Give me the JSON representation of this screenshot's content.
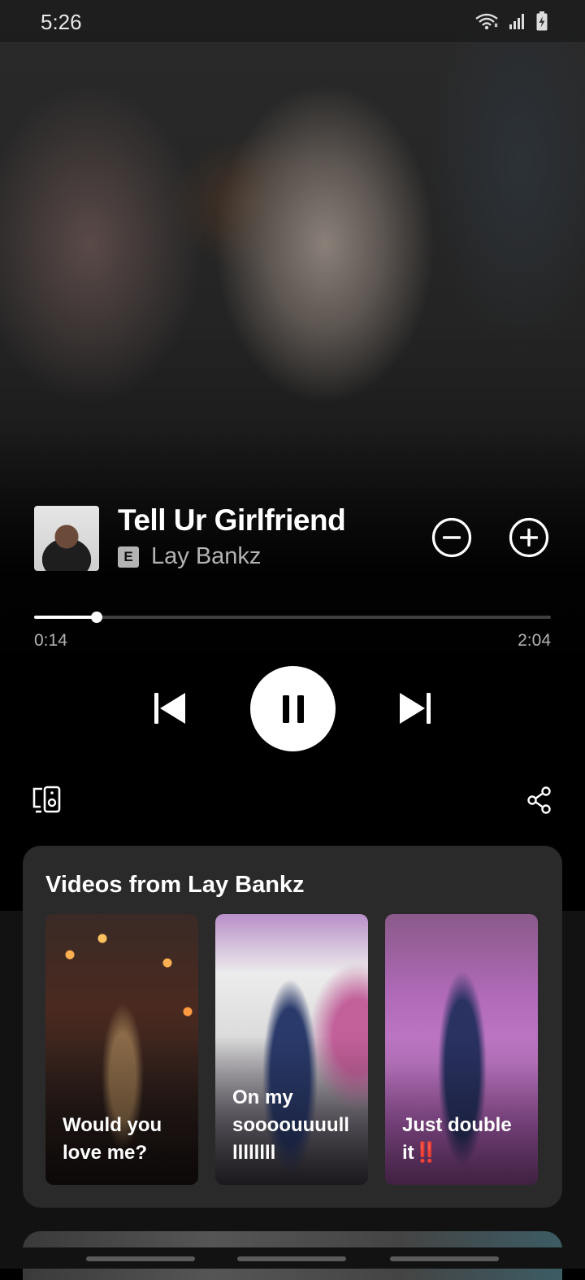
{
  "status_bar": {
    "time": "5:26",
    "icons": [
      "wifi-icon",
      "signal-icon",
      "battery-charging-icon"
    ]
  },
  "track": {
    "title": "Tell Ur Girlfriend",
    "explicit_label": "E",
    "artist": "Lay Bankz",
    "album_art": "album-art-thumbnail"
  },
  "actions": {
    "remove_icon": "minus-circle-icon",
    "add_icon": "plus-circle-icon"
  },
  "playback": {
    "elapsed": "0:14",
    "total": "2:04",
    "progress_fraction": 0.121,
    "state": "playing",
    "controls": [
      "previous-icon",
      "pause-icon",
      "next-icon"
    ]
  },
  "footer_actions": {
    "devices_icon": "connect-devices-icon",
    "share_icon": "share-icon"
  },
  "videos": {
    "heading": "Videos from Lay Bankz",
    "items": [
      {
        "caption": "Would you\nlove me?"
      },
      {
        "caption": "On my\nsoooouuuull\nllllllll"
      },
      {
        "caption": "Just double\nit",
        "emoji": "‼️"
      }
    ]
  },
  "colors": {
    "background": "#000000",
    "card": "#2a2a2a",
    "secondary_text": "#b3b3b3",
    "progress_track": "#3e3e3e"
  }
}
